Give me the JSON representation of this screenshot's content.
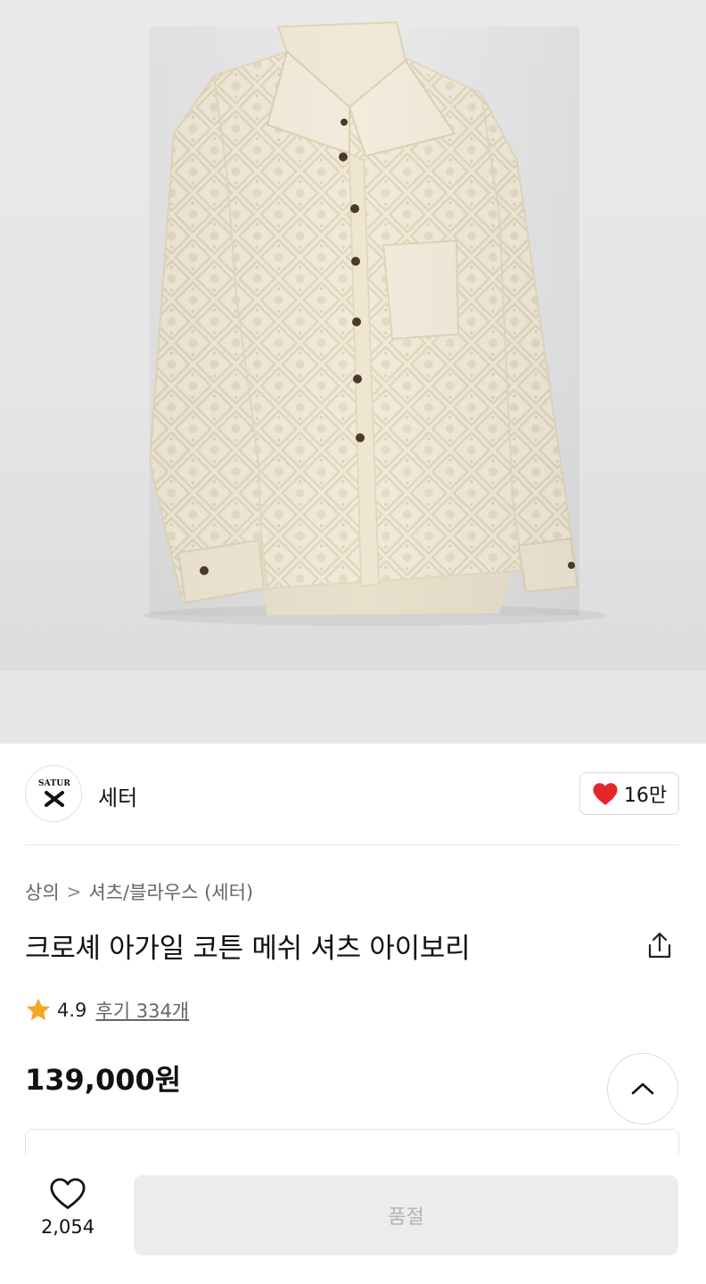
{
  "product_image": {
    "alt": "crochet argyle cotton mesh shirt"
  },
  "brand": {
    "logo_text": "SATUR",
    "name": "세터",
    "likes": "16만"
  },
  "breadcrumb": {
    "category": "상의",
    "separator": ">",
    "subcategory": "셔츠/블라우스 (세터)"
  },
  "product": {
    "title": "크로셰 아가일 코튼 메쉬 셔츠 아이보리",
    "rating": "4.9",
    "reviews_label": "후기 334개",
    "price": "139,000원"
  },
  "bottom_bar": {
    "wish_count": "2,054",
    "buy_label": "품절"
  },
  "colors": {
    "heart_red": "#e52528",
    "star_orange": "#f5a623",
    "text_dark": "#111111",
    "text_gray": "#666666"
  }
}
